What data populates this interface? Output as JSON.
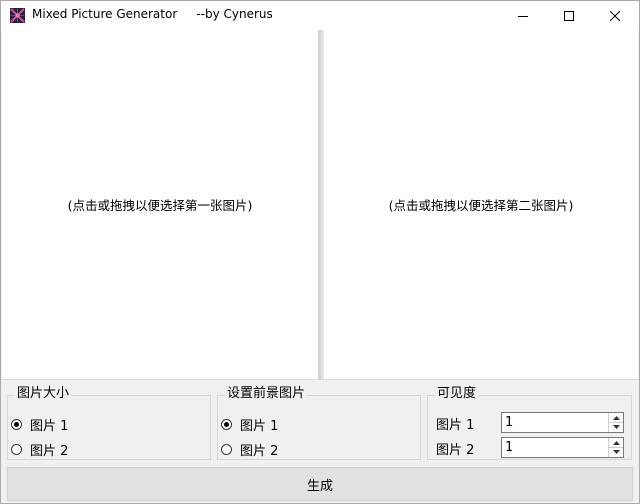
{
  "window": {
    "title": "Mixed Picture Generator     --by Cynerus"
  },
  "panes": {
    "left_hint": "(点击或拖拽以便选择第一张图片)",
    "right_hint": "(点击或拖拽以便选择第二张图片)"
  },
  "size_group": {
    "title": "图片大小",
    "options": [
      "图片 1",
      "图片 2"
    ],
    "selected": "图片 1"
  },
  "foreground_group": {
    "title": "设置前景图片",
    "options": [
      "图片 1",
      "图片 2"
    ],
    "selected": "图片 1"
  },
  "visibility_group": {
    "title": "可见度",
    "rows": [
      {
        "label": "图片 1",
        "value": "1"
      },
      {
        "label": "图片 2",
        "value": "1"
      }
    ]
  },
  "generate_label": "生成",
  "icons": {
    "app": "app-icon",
    "minimize": "minimize-icon",
    "maximize": "maximize-icon",
    "close": "close-icon"
  },
  "colors": {
    "window_bg": "#f0f0f0",
    "pane_bg": "#ffffff",
    "button_bg": "#e1e1e1"
  }
}
